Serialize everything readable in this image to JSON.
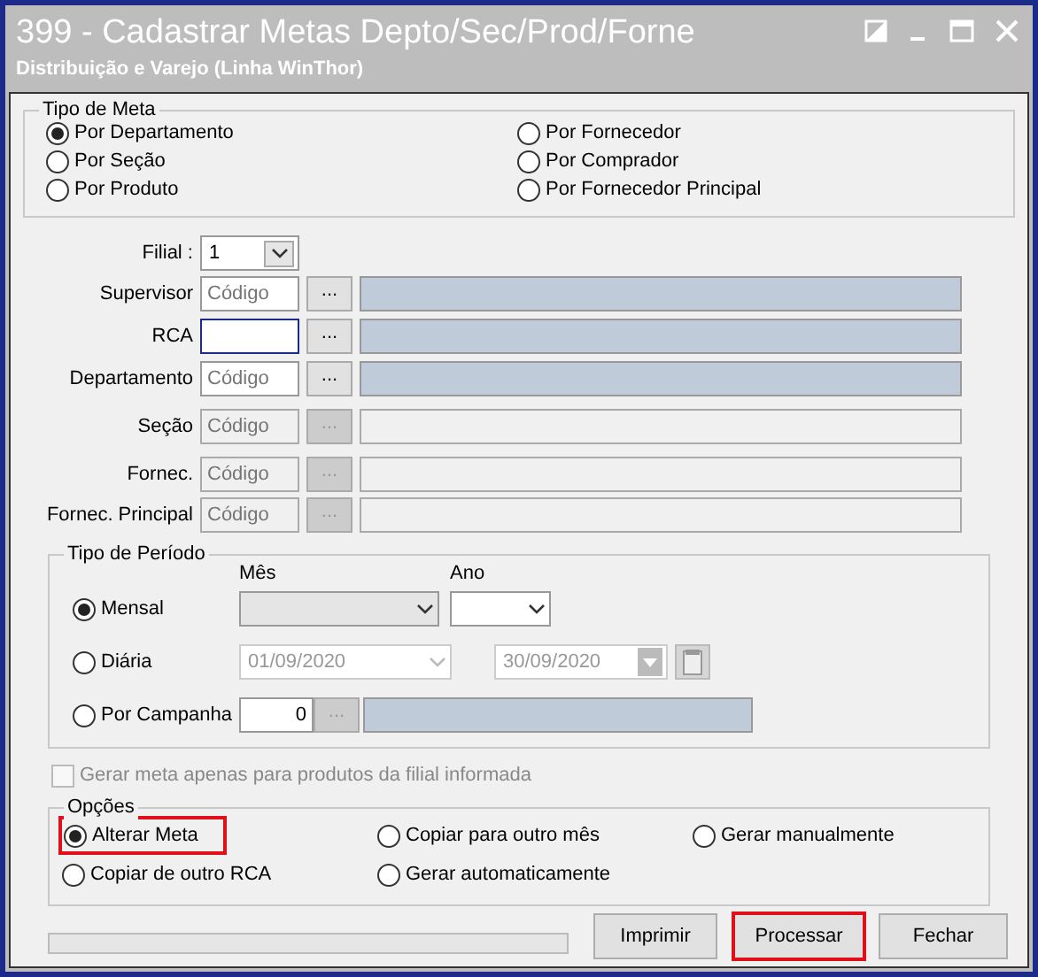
{
  "window": {
    "title": "399 - Cadastrar Metas Depto/Sec/Prod/Forne",
    "subtitle": "Distribuição e Varejo (Linha WinThor)"
  },
  "tipo_de_meta": {
    "legend": "Tipo de Meta",
    "options": [
      {
        "label": "Por Departamento",
        "selected": true
      },
      {
        "label": "Por Fornecedor",
        "selected": false
      },
      {
        "label": "Por Seção",
        "selected": false
      },
      {
        "label": "Por Comprador",
        "selected": false
      },
      {
        "label": "Por Produto",
        "selected": false
      },
      {
        "label": "Por Fornecedor Principal",
        "selected": false
      }
    ]
  },
  "fields": [
    {
      "kind": "combo",
      "label": "Filial :",
      "value": "1"
    },
    {
      "kind": "lookup",
      "label": "Supervisor",
      "placeholder": "Código",
      "button": "...",
      "disabled": false
    },
    {
      "kind": "lookup",
      "label": "RCA",
      "button": "...",
      "disabled": false,
      "focused": true
    },
    {
      "kind": "lookup",
      "label": "Departamento",
      "placeholder": "Código",
      "button": "...",
      "disabled": false
    },
    {
      "kind": "lookup",
      "label": "Seção",
      "placeholder": "Código",
      "button": "...",
      "disabled": true
    },
    {
      "kind": "lookup",
      "label": "Fornec.",
      "placeholder": "Código",
      "button": "...",
      "disabled": true
    },
    {
      "kind": "lookup",
      "label": "Fornec. Principal",
      "placeholder": "Código",
      "button": "...",
      "disabled": true
    }
  ],
  "tipo_de_periodo": {
    "legend": "Tipo de Período",
    "month_label": "Mês",
    "year_label": "Ano",
    "rows": [
      {
        "kind": "month",
        "label": "Mensal",
        "selected": true
      },
      {
        "kind": "dates",
        "label": "Diária",
        "selected": false,
        "start": "01/09/2020",
        "end": "30/09/2020"
      },
      {
        "kind": "campaign",
        "label": "Por Campanha",
        "selected": false,
        "value": "0",
        "button": "..."
      }
    ]
  },
  "filial_checkbox": {
    "label": "Gerar meta apenas para produtos da filial informada",
    "checked": false,
    "disabled": true
  },
  "opcoes": {
    "legend": "Opções",
    "options": [
      {
        "label": "Alterar Meta",
        "selected": true,
        "highlighted": true
      },
      {
        "label": "Copiar para outro mês",
        "selected": false,
        "highlighted": false
      },
      {
        "label": "Gerar manualmente",
        "selected": false,
        "highlighted": false
      },
      {
        "label": "Copiar de outro RCA",
        "selected": false,
        "highlighted": false
      },
      {
        "label": "Gerar automaticamente",
        "selected": false,
        "highlighted": false
      }
    ]
  },
  "progress": {
    "level": 0
  },
  "buttons": [
    {
      "label": "Imprimir",
      "highlighted": false
    },
    {
      "label": "Processar",
      "highlighted": true
    },
    {
      "label": "Fechar",
      "highlighted": false
    }
  ]
}
